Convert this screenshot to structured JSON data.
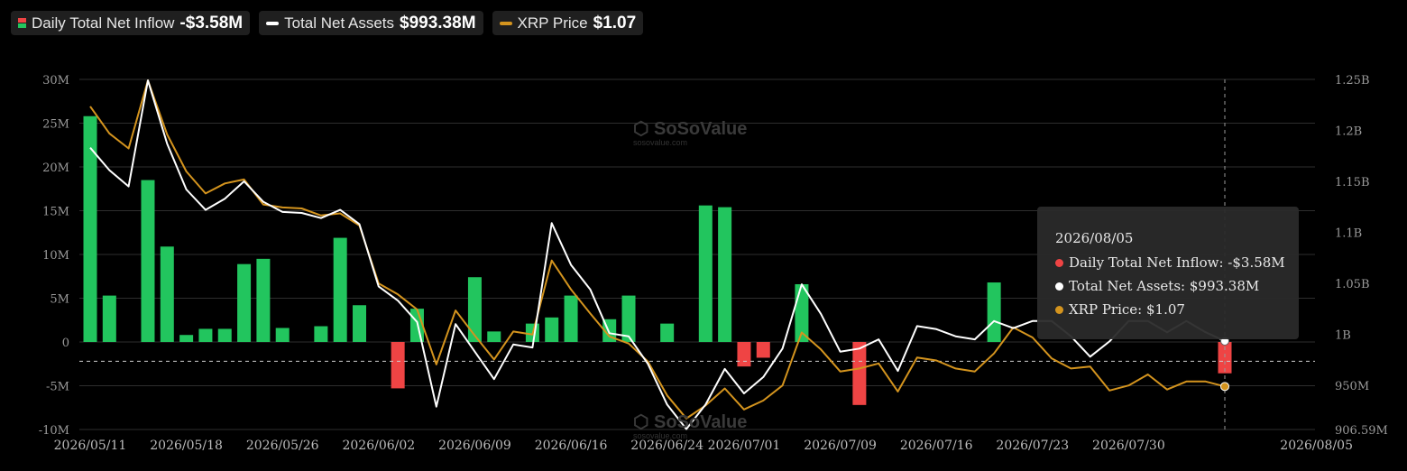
{
  "legend": {
    "inflow_label": "Daily Total Net Inflow",
    "inflow_value": "-$3.58M",
    "assets_label": "Total Net Assets",
    "assets_value": "$993.38M",
    "price_label": "XRP Price",
    "price_value": "$1.07"
  },
  "watermark": {
    "name": "SoSoValue",
    "url": "sosovalue.com"
  },
  "tooltip": {
    "date": "2026/08/05",
    "inflow": "Daily Total Net Inflow: -$3.58M",
    "assets": "Total Net Assets: $993.38M",
    "price": "XRP Price: $1.07"
  },
  "colors": {
    "positive": "#22c55e",
    "negative": "#ef4444",
    "assets_line": "#ffffff",
    "price_line": "#d4941e",
    "grid": "#2e2e2e",
    "axis_text": "#9a9a9a"
  },
  "chart_data": {
    "type": "bar+line",
    "x_tick_labels": [
      "2026/05/11",
      "2026/05/18",
      "2026/05/26",
      "2026/06/02",
      "2026/06/09",
      "2026/06/16",
      "2026/06/24",
      "2026/07/01",
      "2026/07/09",
      "2026/07/16",
      "2026/07/23",
      "2026/07/30",
      "2026/08/05"
    ],
    "x_tick_index": [
      0,
      3,
      6,
      9,
      12,
      15,
      18,
      21,
      24,
      27,
      30,
      33,
      36
    ],
    "y_left_ticks": [
      "30M",
      "25M",
      "20M",
      "15M",
      "10M",
      "5M",
      "0",
      "-5M",
      "-10M"
    ],
    "y_left_values": [
      30,
      25,
      20,
      15,
      10,
      5,
      0,
      -5,
      -10
    ],
    "y_left_range": [
      -10,
      30
    ],
    "y_right_ticks": [
      "1.25B",
      "1.2B",
      "1.15B",
      "1.1B",
      "1.05B",
      "1B",
      "950M",
      "906.59M"
    ],
    "y_right_values": [
      1250,
      1200,
      1150,
      1100,
      1050,
      1000,
      950,
      906.59
    ],
    "y_right_range": [
      906.59,
      1250
    ],
    "reference_line_left": -2.2,
    "grid": true,
    "legend_position": "top-left",
    "n_points": 60,
    "series": [
      {
        "name": "Daily Total Net Inflow",
        "kind": "bar",
        "unit": "M",
        "values": [
          25.8,
          5.3,
          0,
          18.5,
          10.9,
          0.8,
          1.5,
          1.5,
          8.9,
          9.5,
          1.6,
          0,
          1.8,
          11.9,
          4.2,
          0,
          -5.3,
          3.8,
          0,
          0,
          7.4,
          1.2,
          0,
          2.1,
          2.8,
          5.3,
          0,
          2.6,
          5.3,
          0,
          2.1,
          0,
          15.6,
          15.4,
          -2.8,
          -1.8,
          0,
          6.6,
          0,
          0,
          -7.2,
          0,
          0,
          0,
          0,
          0,
          0,
          6.8,
          0,
          0,
          0,
          0,
          0,
          0,
          0,
          0,
          0,
          0,
          0,
          -3.58
        ]
      },
      {
        "name": "Total Net Assets",
        "kind": "line",
        "unit": "M",
        "values": [
          1183,
          1161,
          1145,
          1249,
          1187,
          1142,
          1122,
          1133,
          1150,
          1130,
          1120,
          1119,
          1114,
          1122,
          1108,
          1047,
          1033,
          1012,
          929,
          1010,
          983,
          956,
          990,
          987,
          1109,
          1068,
          1044,
          1001,
          998,
          971,
          931,
          907,
          931,
          966,
          942,
          958,
          986,
          1049,
          1020,
          983,
          986,
          995,
          964,
          1008,
          1005,
          998,
          995,
          1013,
          1006,
          1013,
          1013,
          998,
          978,
          993,
          1013,
          1013,
          1002,
          1013,
          1002,
          993.38
        ]
      },
      {
        "name": "XRP Price",
        "kind": "line",
        "unit": "$",
        "values": [
          1.223,
          1.196,
          1.181,
          1.249,
          1.195,
          1.158,
          1.136,
          1.146,
          1.15,
          1.125,
          1.122,
          1.121,
          1.114,
          1.116,
          1.104,
          1.046,
          1.035,
          1.02,
          0.965,
          1.019,
          0.994,
          0.97,
          0.998,
          0.995,
          1.069,
          1.04,
          1.016,
          0.993,
          0.986,
          0.968,
          0.934,
          0.911,
          0.924,
          0.941,
          0.92,
          0.929,
          0.944,
          0.997,
          0.98,
          0.958,
          0.961,
          0.966,
          0.938,
          0.972,
          0.969,
          0.961,
          0.958,
          0.976,
          1.002,
          0.992,
          0.971,
          0.961,
          0.963,
          0.939,
          0.944,
          0.955,
          0.94,
          0.948,
          0.948,
          0.943
        ]
      }
    ]
  }
}
